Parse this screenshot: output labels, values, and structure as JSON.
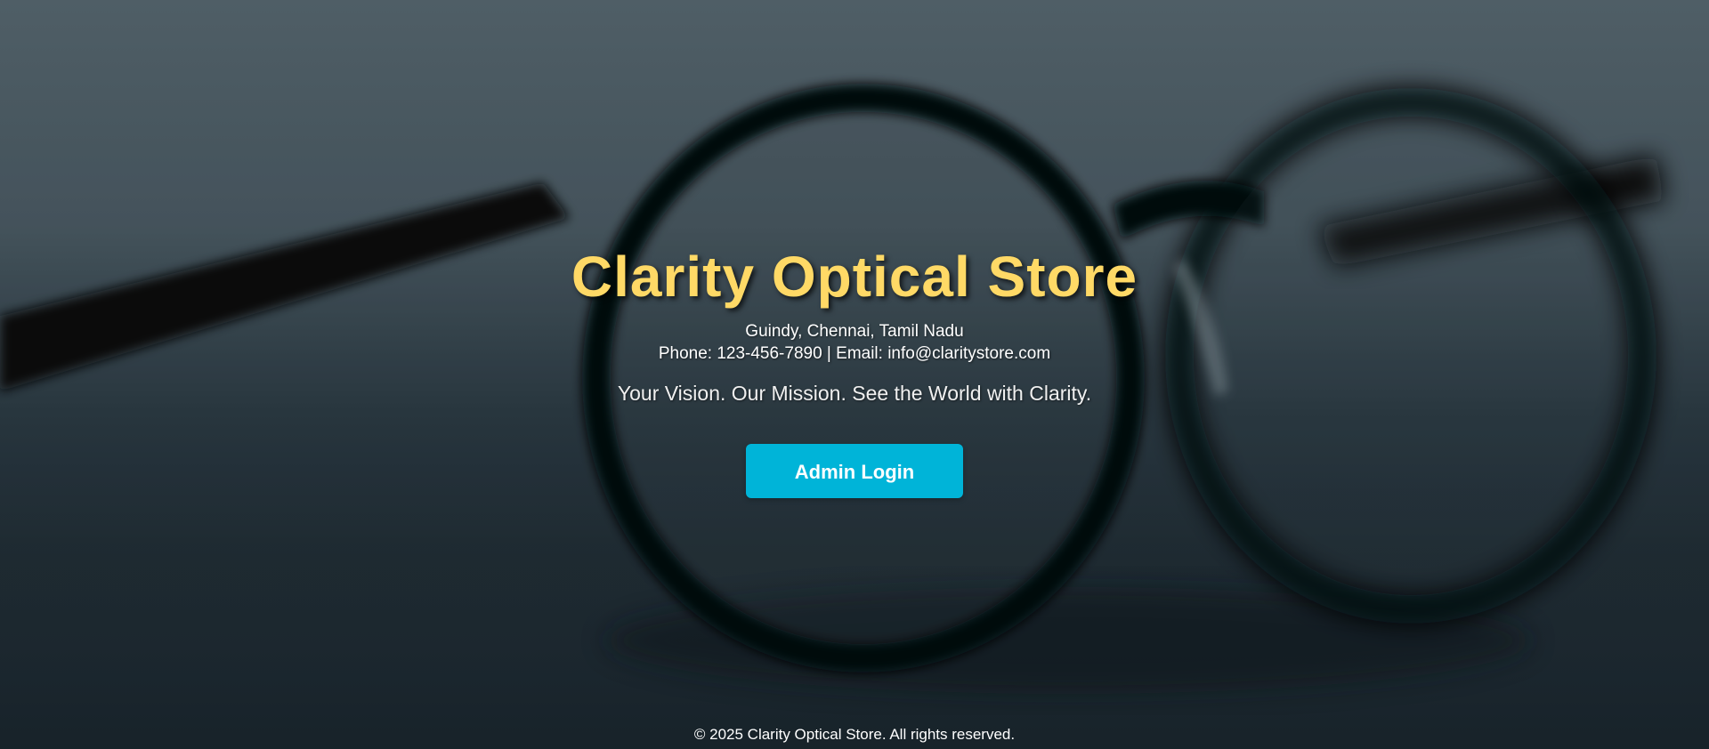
{
  "hero": {
    "title": "Clarity Optical Store",
    "address": "Guindy, Chennai, Tamil Nadu",
    "contact": "Phone: 123-456-7890 | Email: info@claritystore.com",
    "tagline": "Your Vision. Our Mission. See the World with Clarity.",
    "login_label": "Admin Login"
  },
  "footer": {
    "copyright": "© 2025 Clarity Optical Store. All rights reserved."
  },
  "colors": {
    "title": "#ffd966",
    "button": "#00b4d8"
  },
  "background": {
    "image": "eyeglasses-photo"
  }
}
